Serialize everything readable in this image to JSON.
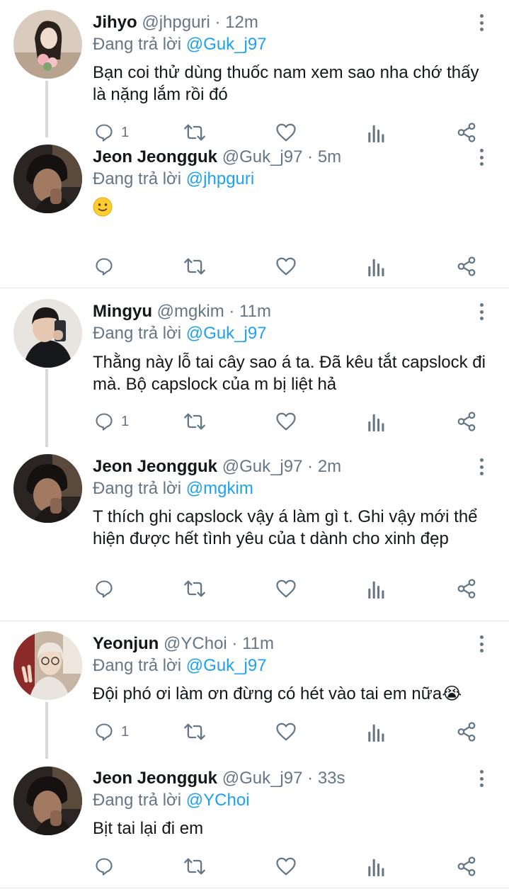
{
  "colors": {
    "accent": "#1da1f2",
    "secondary_text": "#657786",
    "divider": "#e1e8ed"
  },
  "icons": {
    "reply": "reply-icon",
    "retweet": "retweet-icon",
    "like": "like-icon",
    "stats": "stats-icon",
    "share": "share-icon",
    "more": "more-icon"
  },
  "tweets": [
    {
      "name": "Jihyo",
      "handle": "@jhpguri",
      "dot": "·",
      "time": "12m",
      "reply_prefix": "Đang trả lời",
      "reply_to": "@Guk_j97",
      "text": "Bạn coi thử dùng thuốc nam xem sao nha chớ thấy là nặng lắm rồi đó",
      "reply_count": "1"
    },
    {
      "name": "Jeon Jeongguk",
      "handle": "@Guk_j97",
      "dot": "·",
      "time": "5m",
      "reply_prefix": "Đang trả lời",
      "reply_to": "@jhpguri",
      "text": "",
      "emoji": "slightly-smiling-face",
      "reply_count": ""
    },
    {
      "name": "Mingyu",
      "handle": "@mgkim",
      "dot": "·",
      "time": "11m",
      "reply_prefix": "Đang trả lời",
      "reply_to": "@Guk_j97",
      "text": "Thằng này lỗ tai cây sao á ta. Đã kêu tắt capslock đi mà. Bộ capslock của m bị liệt hả",
      "reply_count": "1"
    },
    {
      "name": "Jeon Jeongguk",
      "handle": "@Guk_j97",
      "dot": "·",
      "time": "2m",
      "reply_prefix": "Đang trả lời",
      "reply_to": "@mgkim",
      "text": "T thích ghi capslock vậy á làm gì t. Ghi vậy mới thể hiện được hết tình yêu của t dành cho xinh đẹp",
      "reply_count": ""
    },
    {
      "name": "Yeonjun",
      "handle": "@YChoi",
      "dot": "·",
      "time": "11m",
      "reply_prefix": "Đang trả lời",
      "reply_to": "@Guk_j97",
      "text": "Đội phó ơi làm ơn đừng có hét vào tai em nữa😭",
      "reply_count": "1"
    },
    {
      "name": "Jeon Jeongguk",
      "handle": "@Guk_j97",
      "dot": "·",
      "time": "33s",
      "reply_prefix": "Đang trả lời",
      "reply_to": "@YChoi",
      "text": "Bịt tai lại đi em",
      "reply_count": ""
    }
  ]
}
